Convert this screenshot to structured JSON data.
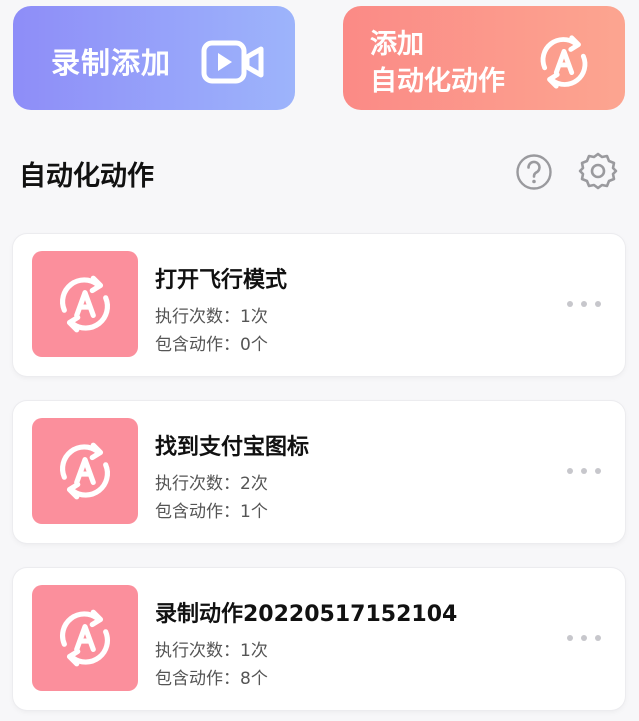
{
  "header": {
    "record_button_label": "录制添加",
    "auto_button_line1": "添加",
    "auto_button_line2": "自动化动作"
  },
  "section": {
    "title": "自动化动作"
  },
  "actions": [
    {
      "name": "打开飞行模式",
      "exec_count": "执行次数：1次",
      "contains": "包含动作：0个"
    },
    {
      "name": "找到支付宝图标",
      "exec_count": "执行次数：2次",
      "contains": "包含动作：1个"
    },
    {
      "name": "录制动作20220517152104",
      "exec_count": "执行次数：1次",
      "contains": "包含动作：8个"
    }
  ],
  "icons": {
    "record": "video-camera-icon",
    "auto": "auto-cycle-icon",
    "help": "question-circle-icon",
    "settings": "gear-icon",
    "more": "more-dots-icon"
  },
  "colors": {
    "record_start": "#8e8df8",
    "record_end": "#9db4fb",
    "auto_start": "#fb8a86",
    "auto_end": "#fca590",
    "thumb": "#fb8f9c"
  }
}
